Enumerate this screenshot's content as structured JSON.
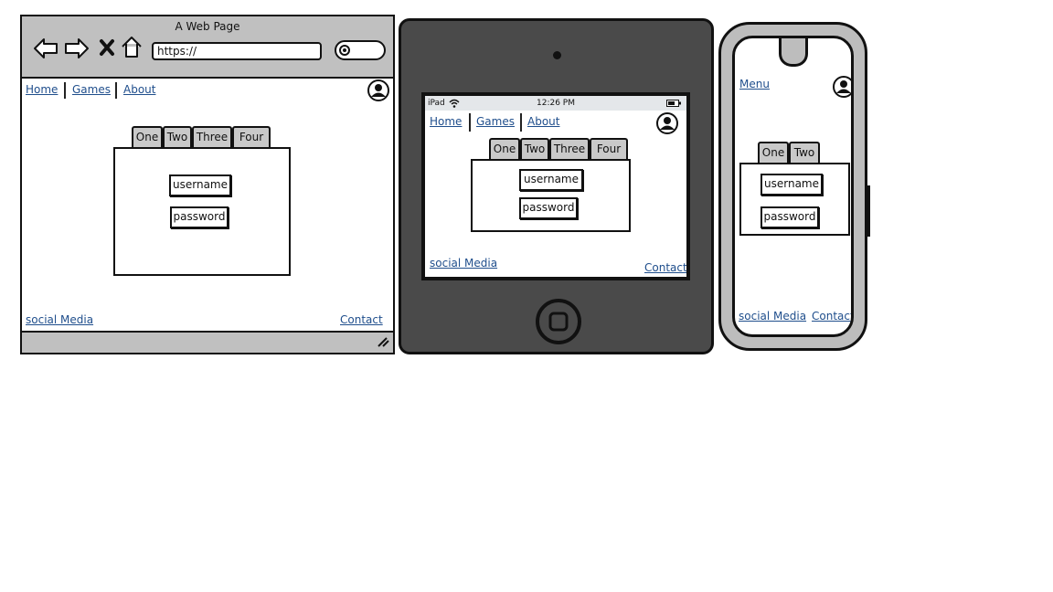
{
  "browser": {
    "title": "A Web Page",
    "url": "https://",
    "nav": {
      "home": "Home",
      "games": "Games",
      "about": "About"
    },
    "tabs": [
      "One",
      "Two",
      "Three",
      "Four"
    ],
    "username": "username",
    "password": "password",
    "footer": {
      "social": "social Media",
      "contact": "Contact"
    }
  },
  "ipad": {
    "carrier": "iPad",
    "time": "12:26 PM",
    "nav": {
      "home": "Home",
      "games": "Games",
      "about": "About"
    },
    "tabs": [
      "One",
      "Two",
      "Three",
      "Four"
    ],
    "username": "username",
    "password": "password",
    "footer": {
      "social": "social Media",
      "contact": "Contact"
    }
  },
  "phone": {
    "menu": "Menu",
    "tabs": [
      "One",
      "Two"
    ],
    "username": "username",
    "password": "password",
    "footer": {
      "social": "social Media",
      "contact": "Contact"
    }
  },
  "colors": {
    "link": "#1f4e8c",
    "chrome": "#c0c0c0",
    "tablet_body": "#4a4a4a",
    "phone_body": "#bdbdbd"
  },
  "icons": [
    "back-arrow-icon",
    "forward-arrow-icon",
    "close-icon",
    "home-icon",
    "search-icon",
    "avatar-icon",
    "wifi-icon",
    "battery-icon",
    "home-button-icon",
    "resize-grip-icon"
  ]
}
